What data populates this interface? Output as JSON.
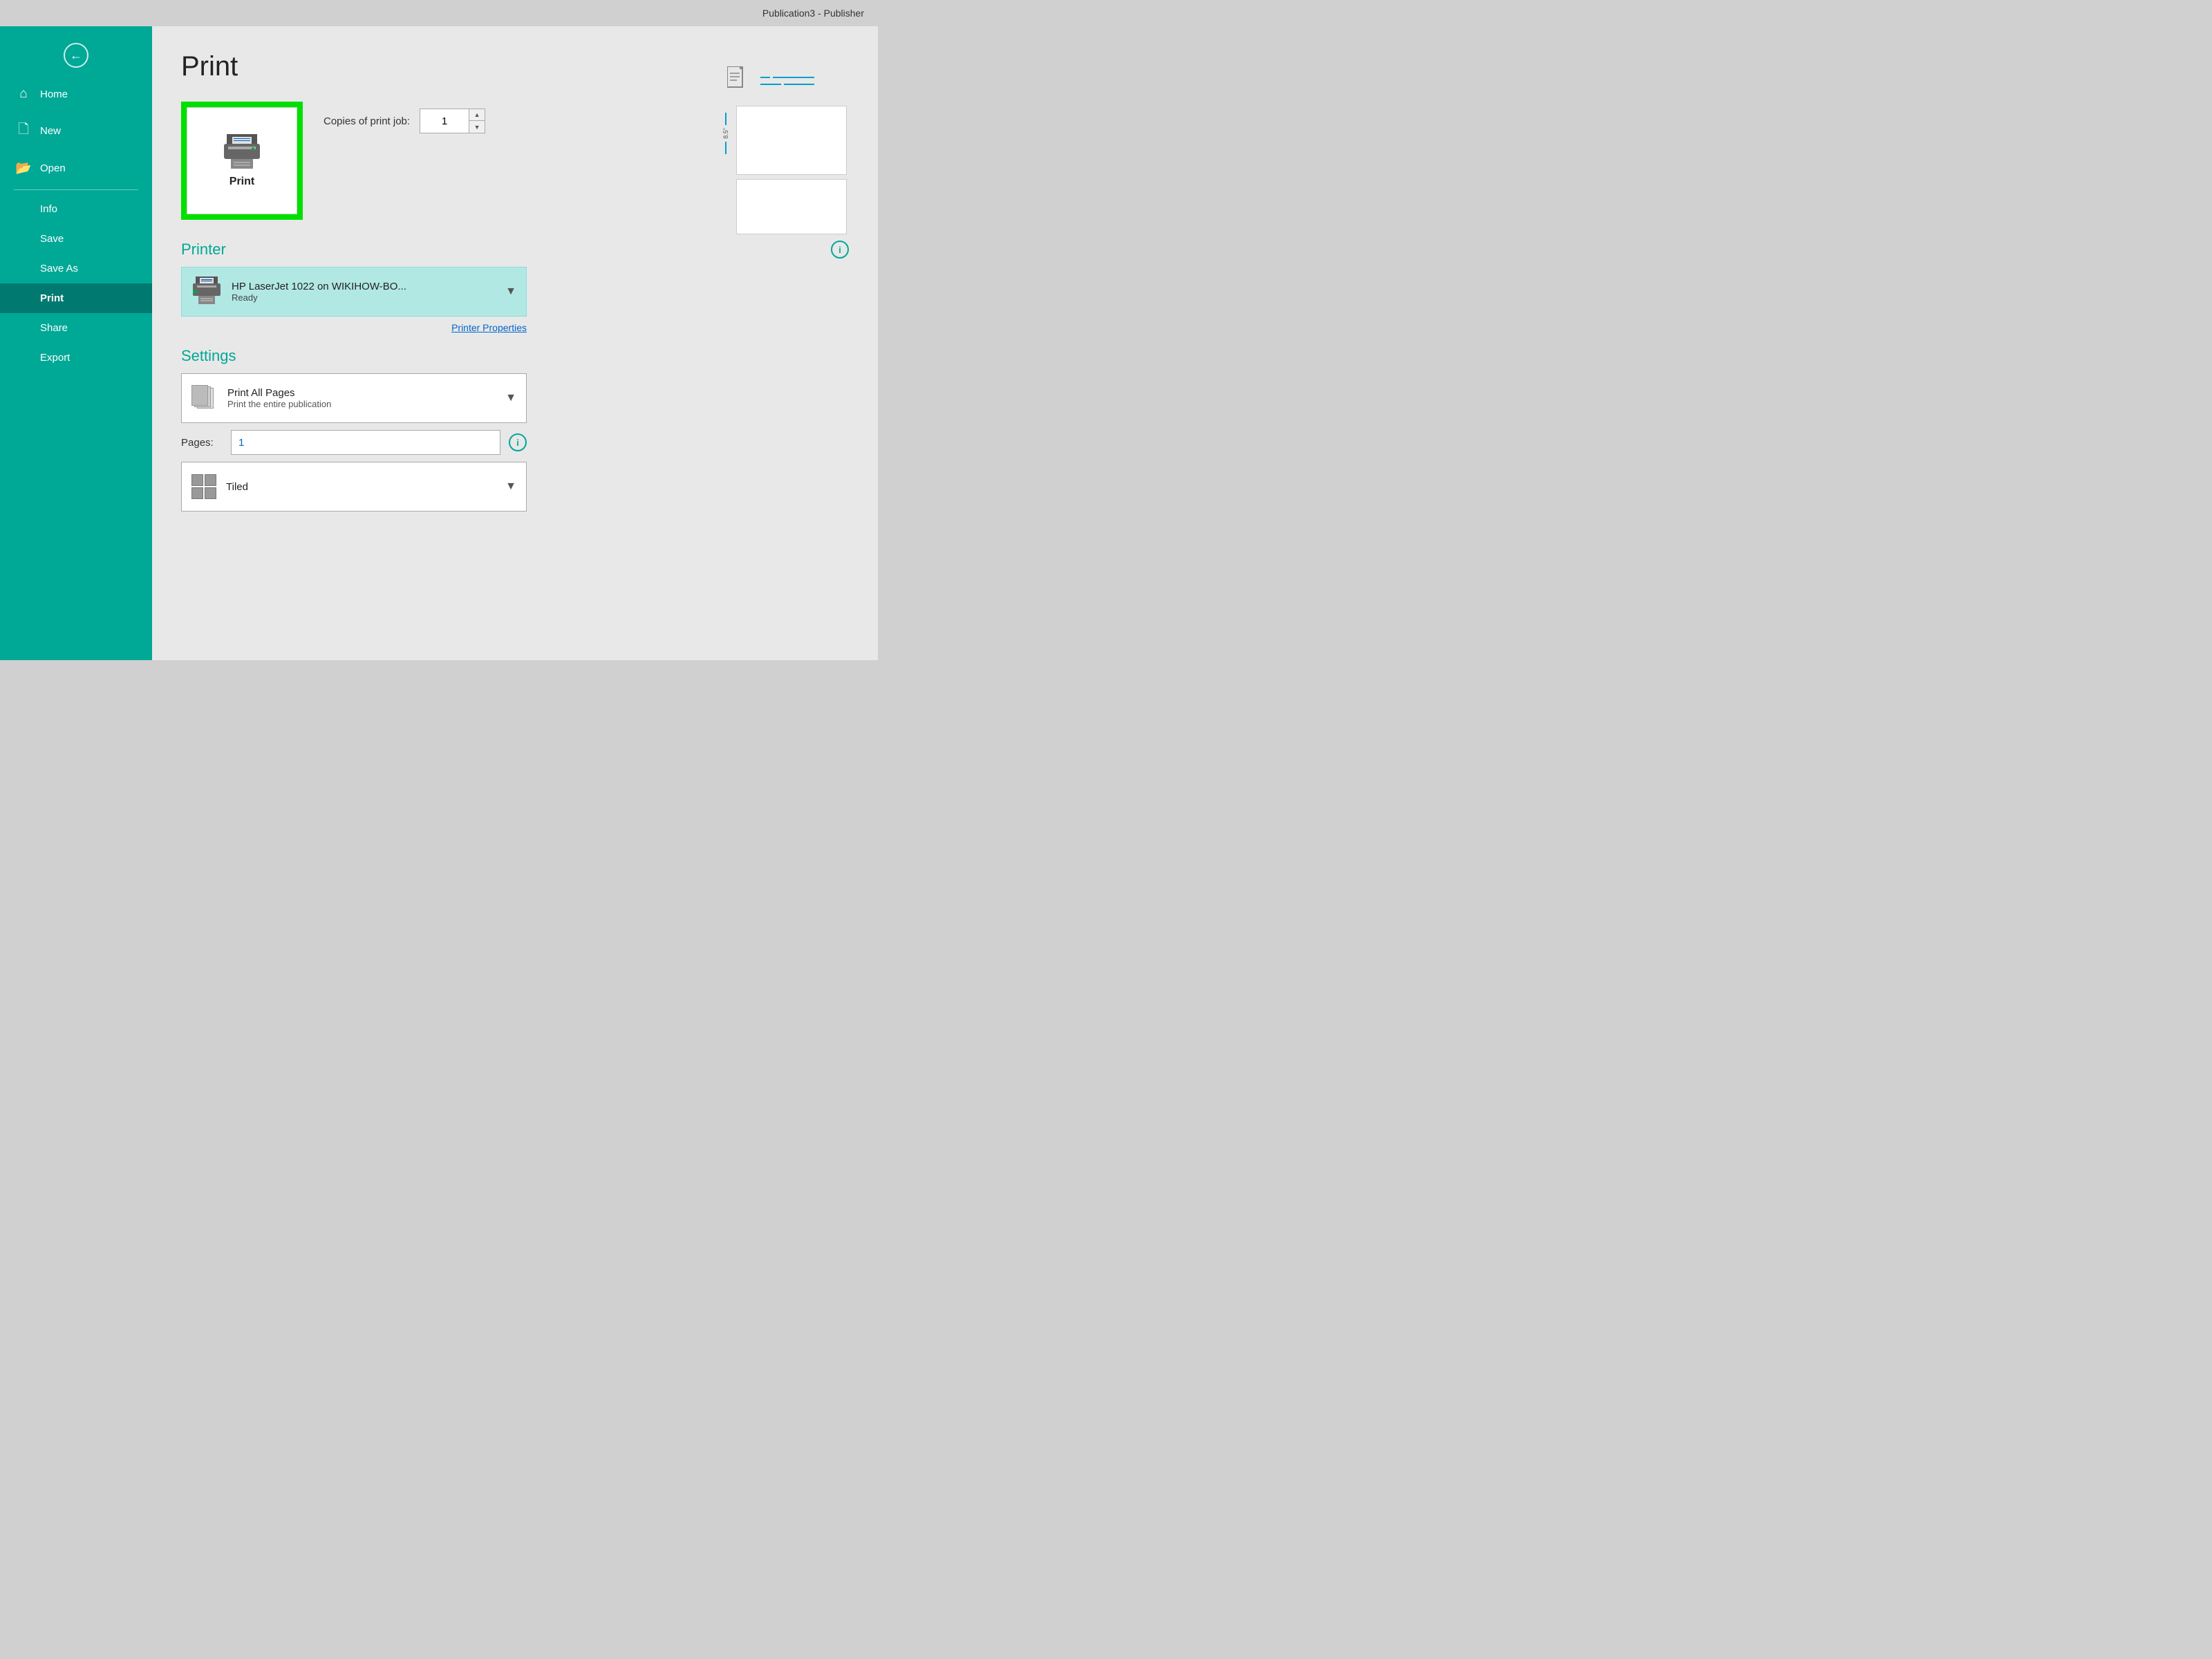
{
  "titleBar": {
    "text": "Publication3  -  Publisher"
  },
  "sidebar": {
    "backLabel": "←",
    "items": [
      {
        "id": "home",
        "label": "Home",
        "icon": "⌂"
      },
      {
        "id": "new",
        "label": "New",
        "icon": "🗋"
      },
      {
        "id": "open",
        "label": "Open",
        "icon": "📂"
      }
    ],
    "textItems": [
      {
        "id": "info",
        "label": "Info",
        "active": false
      },
      {
        "id": "save",
        "label": "Save",
        "active": false
      },
      {
        "id": "save-as",
        "label": "Save As",
        "active": false
      },
      {
        "id": "print",
        "label": "Print",
        "active": true
      },
      {
        "id": "share",
        "label": "Share",
        "active": false
      },
      {
        "id": "export",
        "label": "Export",
        "active": false
      }
    ]
  },
  "main": {
    "title": "Print",
    "printButton": {
      "label": "Print"
    },
    "copies": {
      "label": "Copies of print job:",
      "value": "1"
    },
    "printer": {
      "sectionLabel": "Printer",
      "name": "HP LaserJet 1022 on WIKIHOW-BO...",
      "status": "Ready",
      "propertiesLink": "Printer Properties"
    },
    "settings": {
      "sectionLabel": "Settings",
      "printAllPages": {
        "main": "Print All Pages",
        "sub": "Print the entire publication"
      },
      "pages": {
        "label": "Pages:",
        "value": "1"
      },
      "tiled": {
        "label": "Tiled"
      }
    },
    "preview": {
      "rulerLabel": "8.5\""
    }
  }
}
